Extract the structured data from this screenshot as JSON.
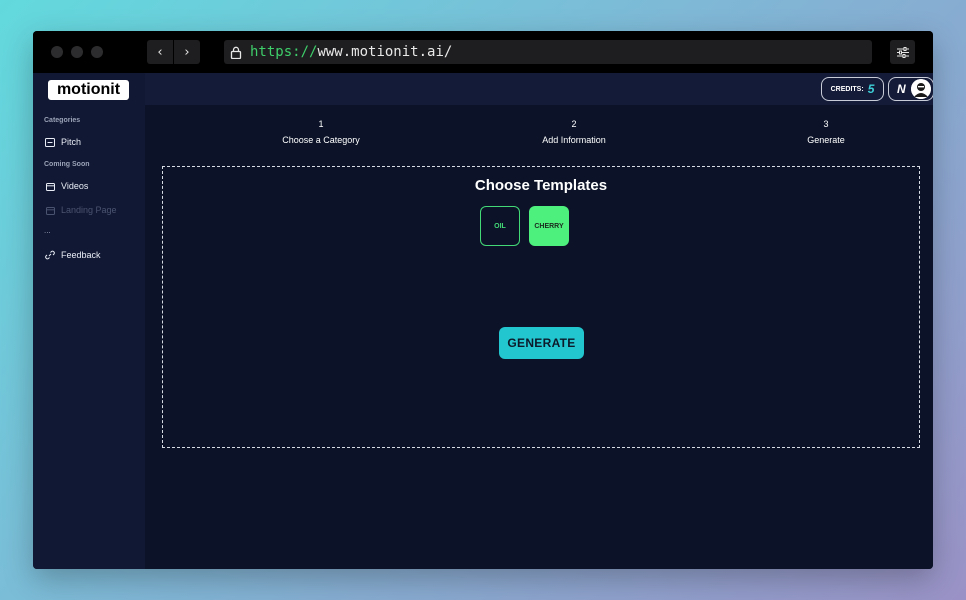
{
  "browser": {
    "url_scheme": "https://",
    "url_rest": "www.motionit.ai/"
  },
  "sidebar": {
    "logo": "motionit",
    "section_categories": "Categories",
    "item_pitch": "Pitch",
    "section_coming_soon": "Coming Soon",
    "item_videos": "Videos",
    "item_landing": "Landing Page",
    "ellipsis": "...",
    "item_feedback": "Feedback"
  },
  "header": {
    "credits_label": "CREDITS:",
    "credits_count": "5",
    "profile_initial": "N"
  },
  "steps": [
    {
      "num": "1",
      "label": "Choose a Category"
    },
    {
      "num": "2",
      "label": "Add Information"
    },
    {
      "num": "3",
      "label": "Generate"
    }
  ],
  "templates": {
    "title": "Choose Templates",
    "oil": "OIL",
    "cherry": "CHERRY"
  },
  "actions": {
    "generate": "GENERATE"
  },
  "colors": {
    "accent_cyan": "#22c6cf",
    "accent_green": "#4ef07d",
    "background": "#0c1328",
    "sidebar": "#111833"
  }
}
